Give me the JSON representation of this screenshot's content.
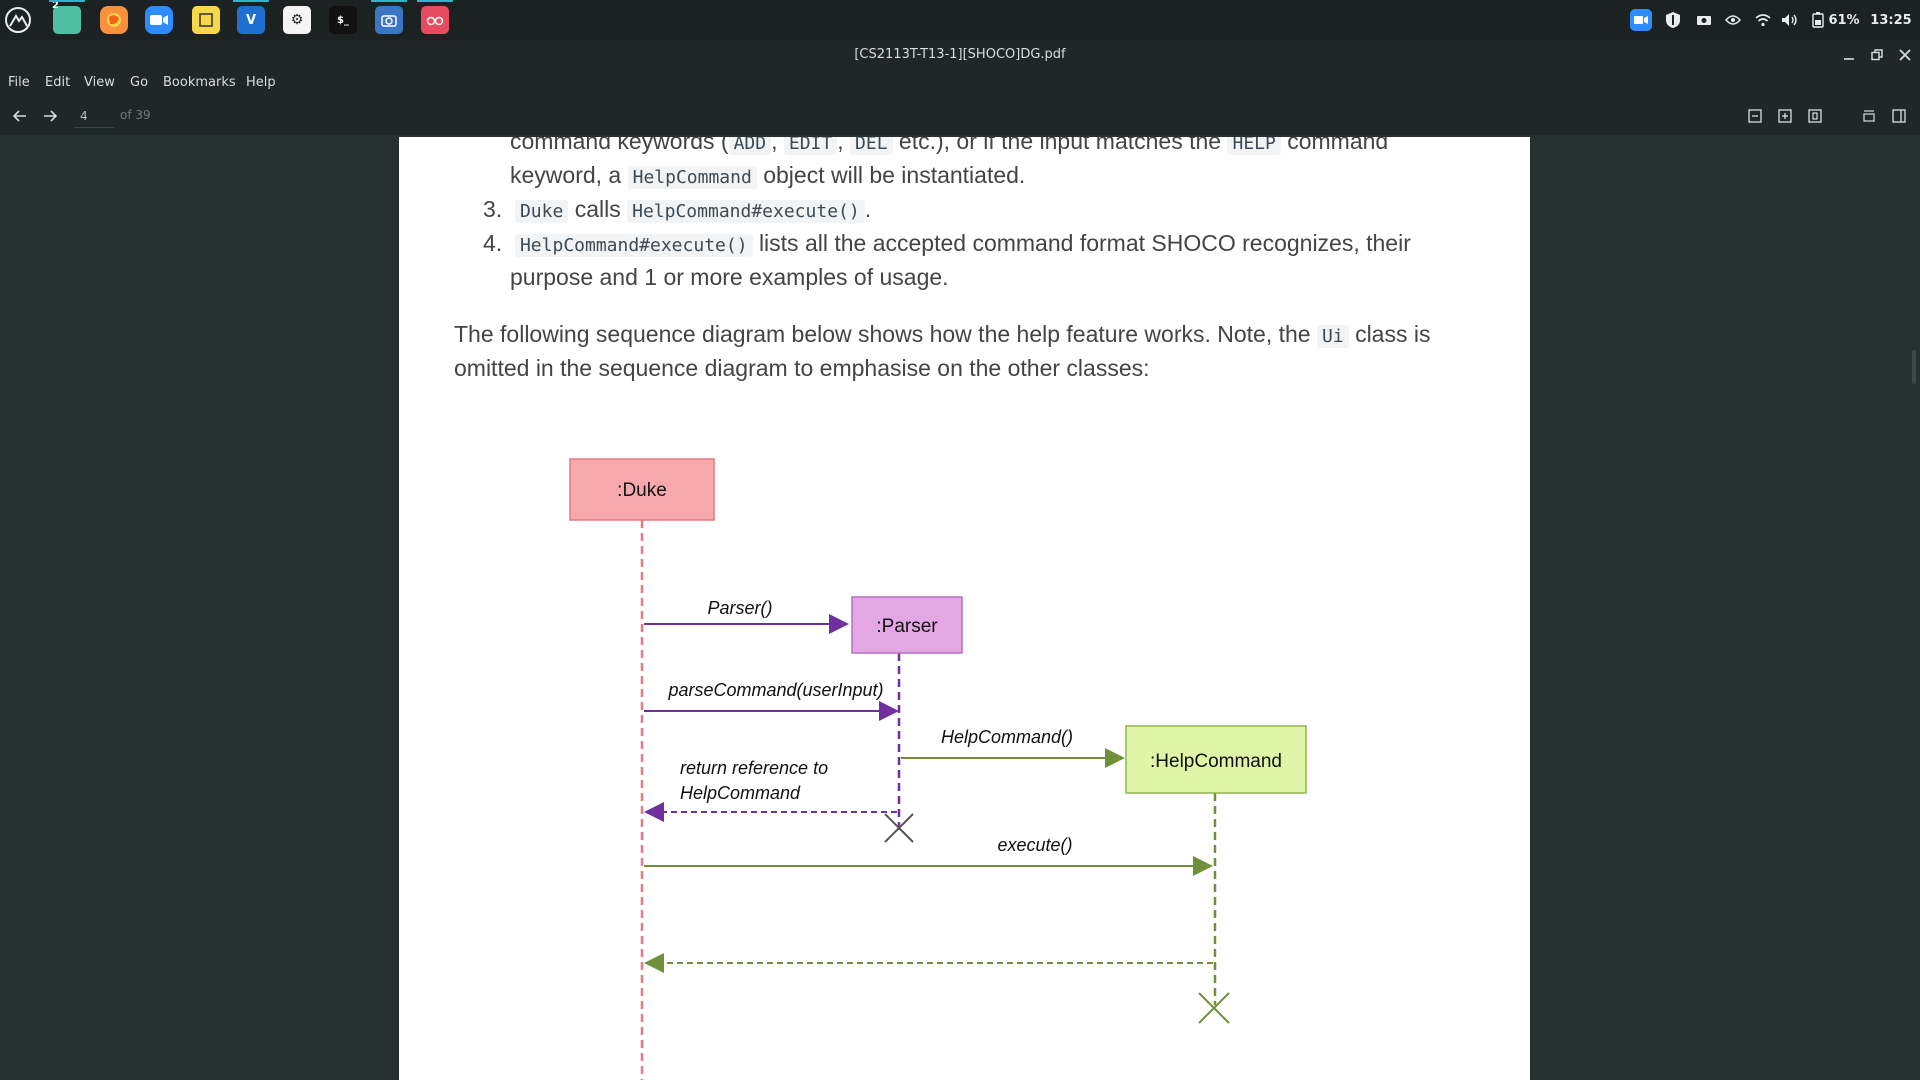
{
  "taskbar": {
    "files_badge": "2",
    "battery": "61%",
    "clock": "13:25",
    "apps": [
      "menu-icon",
      "files-icon",
      "firefox-icon",
      "zoom-icon",
      "notes-icon",
      "vscode-icon",
      "settings-icon",
      "terminal-icon",
      "screenshot-icon",
      "reader-icon"
    ]
  },
  "window": {
    "title": "[CS2113T-T13-1][SHOCO]DG.pdf"
  },
  "menu": {
    "file": "File",
    "edit": "Edit",
    "view": "View",
    "go": "Go",
    "bookmarks": "Bookmarks",
    "help": "Help"
  },
  "toolbar": {
    "page_value": "4",
    "page_total": "of 39"
  },
  "document": {
    "line1": {
      "pre": "command keywords (",
      "add": "ADD",
      "c1": ",",
      "edit": "EDIT",
      "c2": ",",
      "del": "DEL",
      "mid": "etc.), or if the input matches the",
      "help": "HELP",
      "post": "command"
    },
    "line2": {
      "pre": "keyword, a",
      "code": "HelpCommand",
      "post": "object will be instantiated."
    },
    "item3": {
      "num": "3.",
      "code1": "Duke",
      "mid": "calls",
      "code2": "HelpCommand#execute()",
      "post": "."
    },
    "item4": {
      "num": "4.",
      "code": "HelpCommand#execute()",
      "post": "lists all the accepted command format SHOCO recognizes, their",
      "line2": "purpose and 1 or more examples of usage."
    },
    "para": {
      "pre": "The following sequence diagram below shows how the help feature works. Note, the",
      "code": "Ui",
      "post": "class is",
      "line2": "omitted in the sequence diagram to emphasise on the other classes:"
    }
  },
  "diagram": {
    "duke": ":Duke",
    "parser": ":Parser",
    "helpcommand": ":HelpCommand",
    "msg_parser": "Parser()",
    "msg_parse": "parseCommand(userInput)",
    "msg_help": "HelpCommand()",
    "msg_return1": "return reference to",
    "msg_return2": "HelpCommand",
    "msg_execute": "execute()",
    "colors": {
      "duke_fill": "#f7a8ad",
      "parser_fill": "#e3a7e3",
      "help_fill": "#dff5a8",
      "purple": "#7030a0",
      "green": "#70913a"
    }
  }
}
